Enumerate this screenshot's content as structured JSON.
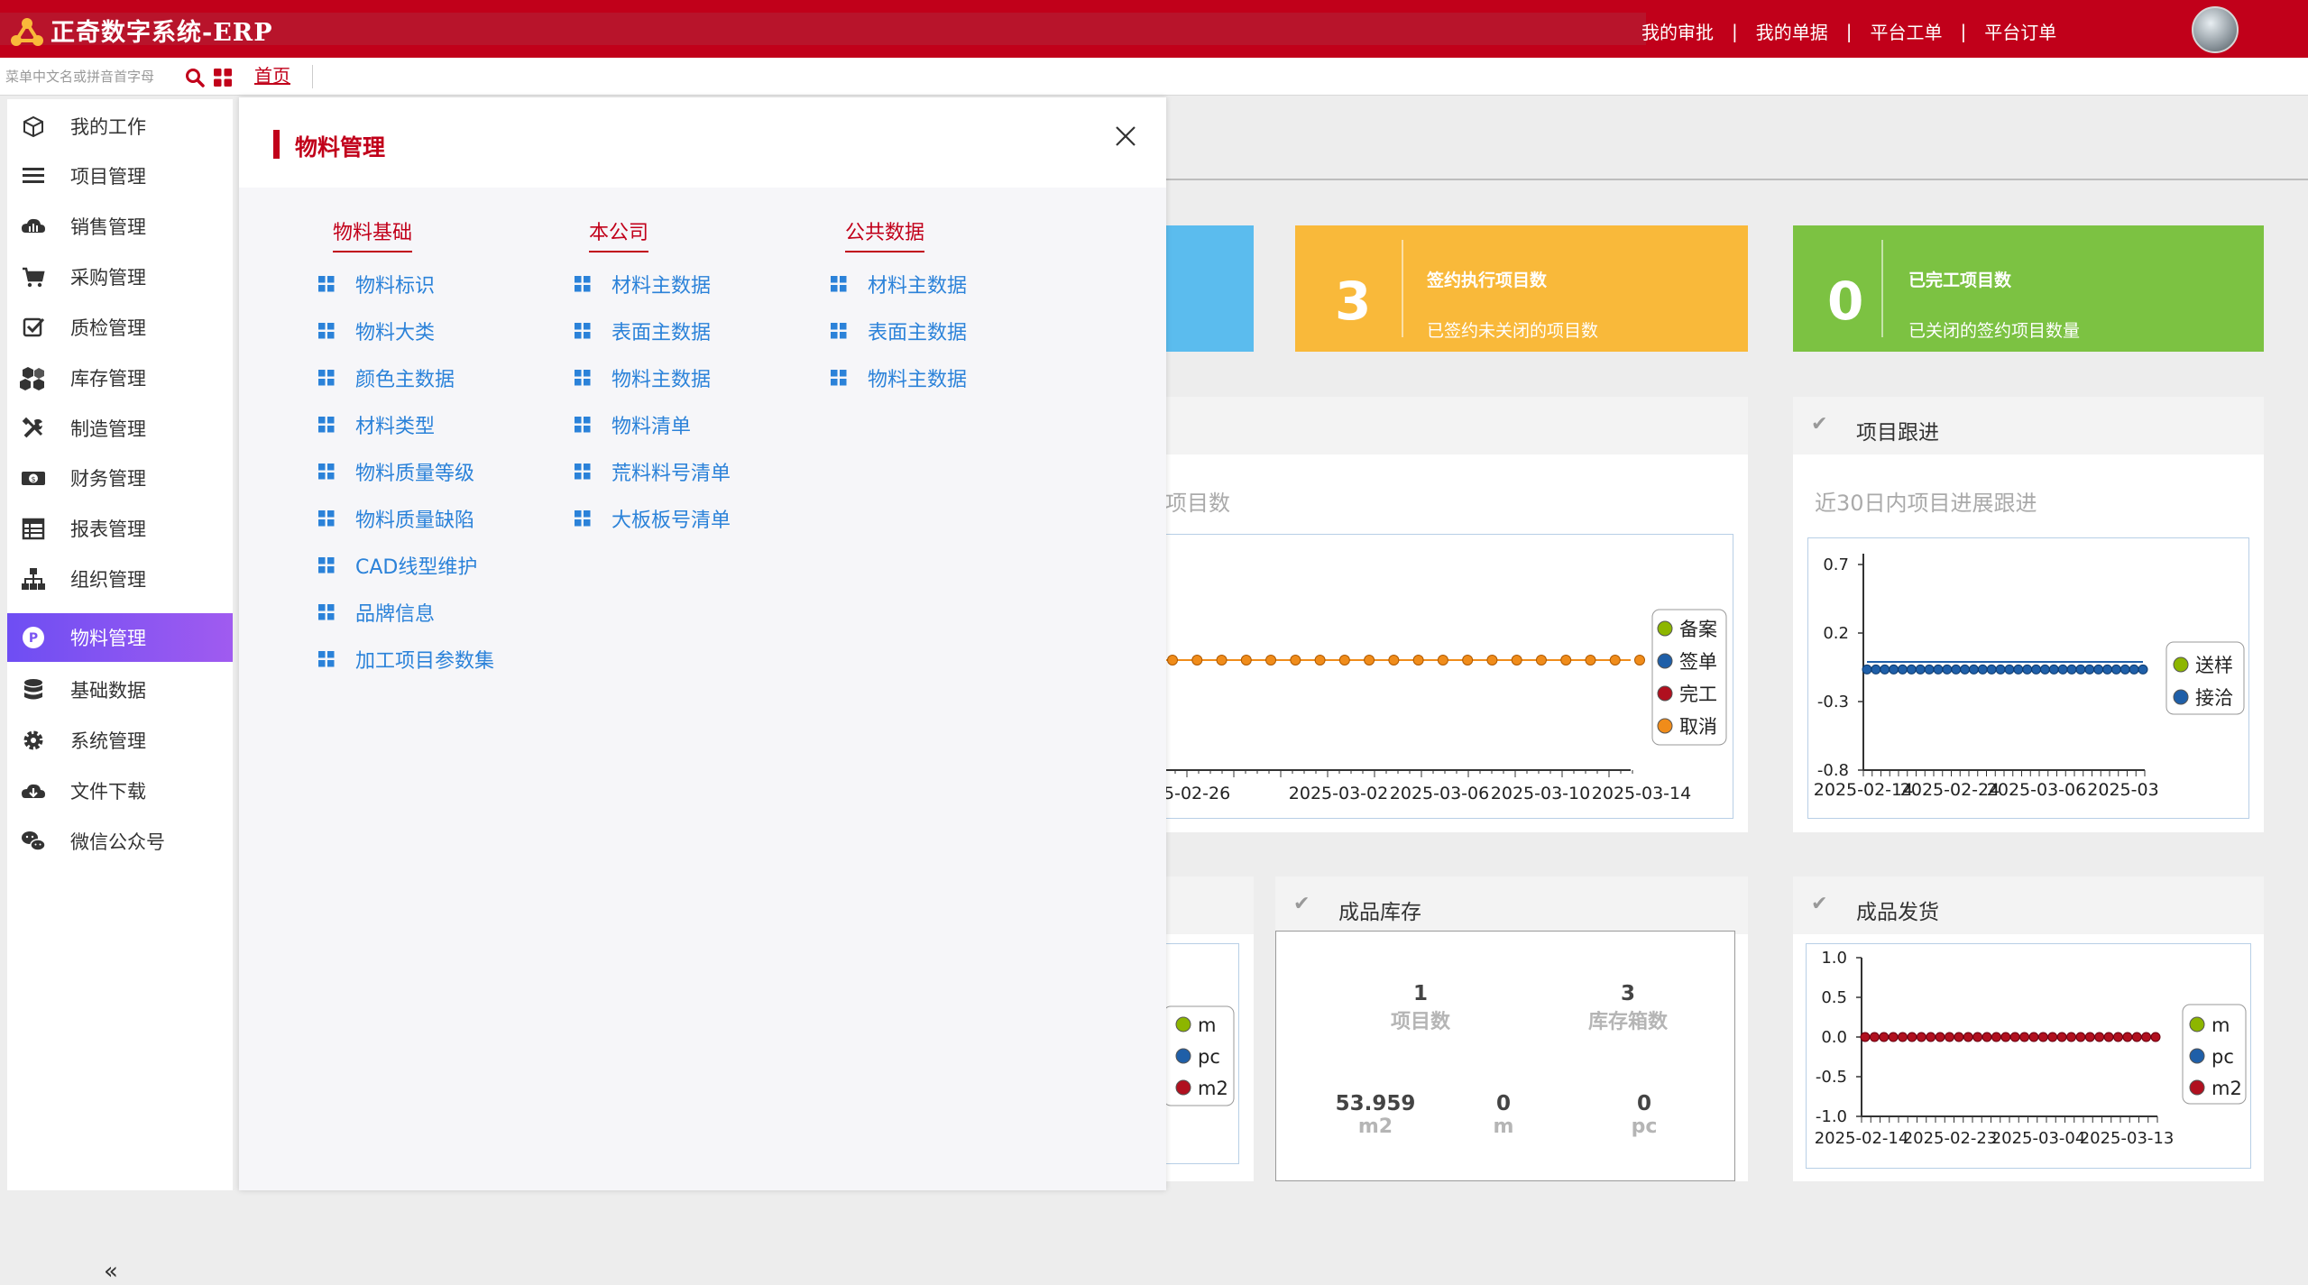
{
  "app": {
    "title": "正奇数字系统-ERP"
  },
  "top_links": [
    "我的审批",
    "我的单据",
    "平台工单",
    "平台订单"
  ],
  "menu_search": {
    "placeholder": "菜单中文名或拼音首字母"
  },
  "tabs": [
    {
      "label": "首页",
      "active": true
    }
  ],
  "sidebar": {
    "items": [
      {
        "label": "我的工作",
        "icon": "cube-icon"
      },
      {
        "label": "项目管理",
        "icon": "list-icon"
      },
      {
        "label": "销售管理",
        "icon": "cloud-chart-icon"
      },
      {
        "label": "采购管理",
        "icon": "cart-icon"
      },
      {
        "label": "质检管理",
        "icon": "checkbox-icon"
      },
      {
        "label": "库存管理",
        "icon": "boxes-icon"
      },
      {
        "label": "制造管理",
        "icon": "tools-icon"
      },
      {
        "label": "财务管理",
        "icon": "money-icon"
      },
      {
        "label": "报表管理",
        "icon": "table-icon"
      },
      {
        "label": "组织管理",
        "icon": "org-icon"
      },
      {
        "label": "物料管理",
        "icon": "p-circle-icon",
        "active": true
      },
      {
        "label": "基础数据",
        "icon": "database-icon"
      },
      {
        "label": "系统管理",
        "icon": "gear-icon"
      },
      {
        "label": "文件下载",
        "icon": "cloud-download-icon"
      },
      {
        "label": "微信公众号",
        "icon": "wechat-icon"
      }
    ],
    "collapse_label": "«"
  },
  "modal": {
    "title": "物料管理",
    "columns": [
      {
        "heading": "物料基础",
        "items": [
          "物料标识",
          "物料大类",
          "颜色主数据",
          "材料类型",
          "物料质量等级",
          "物料质量缺陷",
          "CAD线型维护",
          "品牌信息",
          "加工项目参数集"
        ]
      },
      {
        "heading": "本公司",
        "items": [
          "材料主数据",
          "表面主数据",
          "物料主数据",
          "物料清单",
          "荒料料号清单",
          "大板板号清单"
        ]
      },
      {
        "heading": "公共数据",
        "items": [
          "材料主数据",
          "表面主数据",
          "物料主数据"
        ]
      }
    ]
  },
  "dashboard": {
    "stats": [
      {
        "value": "3",
        "title": "签约执行项目数",
        "subtitle": "已签约未关闭的项目数",
        "color": "#f9b93a"
      },
      {
        "value": "0",
        "title": "已完工项目数",
        "subtitle": "已关闭的签约项目数量",
        "color": "#7cc242"
      }
    ],
    "stat_partial_color": "#5bbcee",
    "panels": {
      "partial_subtitle": "项目数",
      "project_follow": {
        "title": "项目跟进",
        "subtitle": "近30日内项目进展跟进"
      },
      "finished_stock": {
        "title": "成品库存",
        "cells": [
          {
            "value": "1",
            "label": "项目数"
          },
          {
            "value": "3",
            "label": "库存箱数"
          },
          {
            "value": "53.959",
            "label": "m2"
          },
          {
            "value": "0",
            "label": "m"
          },
          {
            "value": "0",
            "label": "pc"
          }
        ]
      },
      "finished_delivery": {
        "title": "成品发货"
      }
    }
  },
  "chart_data": [
    {
      "type": "line",
      "x_ticks": [
        "5-02-26",
        "2025-03-02",
        "2025-03-06",
        "2025-03-10",
        "2025-03-14"
      ],
      "series": [
        {
          "name": "备案",
          "color": "#8db600"
        },
        {
          "name": "签单",
          "color": "#1f5fa8"
        },
        {
          "name": "完工",
          "color": "#b0101f"
        },
        {
          "name": "取消",
          "color": "#f08c1a",
          "values": [
            0,
            0,
            0,
            0,
            0,
            0,
            0,
            0,
            0,
            0,
            0,
            0,
            0,
            0,
            0,
            0,
            0,
            0,
            0,
            0
          ]
        }
      ]
    },
    {
      "type": "line",
      "y_ticks": [
        "0.7",
        "0.2",
        "-0.3",
        "-0.8"
      ],
      "ylim": [
        -0.8,
        0.7
      ],
      "x_ticks": [
        "2025-02-14",
        "2025-02-24",
        "2025-03-06",
        "2025-03"
      ],
      "series": [
        {
          "name": "送样",
          "color": "#8db600"
        },
        {
          "name": "接洽",
          "color": "#1f5fa8",
          "values": [
            0,
            0,
            0,
            0,
            0,
            0,
            0,
            0,
            0,
            0,
            0,
            0,
            0,
            0,
            0,
            0,
            0,
            0,
            0,
            0,
            0,
            0,
            0,
            0,
            0,
            0,
            0,
            0,
            0,
            0,
            0,
            0
          ]
        }
      ]
    },
    {
      "type": "line",
      "series": [
        {
          "name": "m",
          "color": "#8db600"
        },
        {
          "name": "pc",
          "color": "#1f5fa8"
        },
        {
          "name": "m2",
          "color": "#b0101f"
        }
      ]
    },
    {
      "type": "line",
      "y_ticks": [
        "1.0",
        "0.5",
        "0.0",
        "-0.5",
        "-1.0"
      ],
      "ylim": [
        -1.0,
        1.0
      ],
      "x_ticks": [
        "2025-02-14",
        "2025-02-23",
        "2025-03-04",
        "2025-03-13"
      ],
      "series": [
        {
          "name": "m",
          "color": "#8db600"
        },
        {
          "name": "pc",
          "color": "#1f5fa8"
        },
        {
          "name": "m2",
          "color": "#b0101f",
          "values": [
            0,
            0,
            0,
            0,
            0,
            0,
            0,
            0,
            0,
            0,
            0,
            0,
            0,
            0,
            0,
            0,
            0,
            0,
            0,
            0,
            0,
            0,
            0,
            0,
            0,
            0,
            0,
            0,
            0,
            0,
            0,
            0
          ]
        }
      ]
    }
  ]
}
